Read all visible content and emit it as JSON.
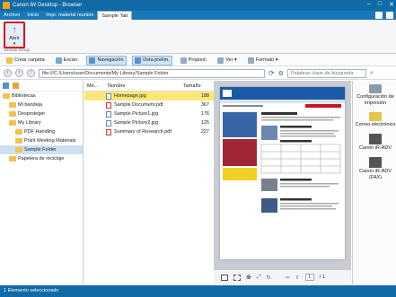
{
  "window": {
    "title": "Canon iW Desktop - Browser",
    "controls": [
      "–",
      "□",
      "✕"
    ]
  },
  "menubar": {
    "tabs": [
      {
        "label": "Archivo",
        "active": false
      },
      {
        "label": "Inicio",
        "active": false
      },
      {
        "label": "Impr. material reunión",
        "active": false
      },
      {
        "label": "Sample Tab",
        "active": true
      }
    ]
  },
  "ribbon": {
    "open_label": "Abrir",
    "group_label": "Sample Group"
  },
  "toolbar": {
    "items": [
      {
        "label": "Crear carpeta",
        "active": false
      },
      {
        "label": "Escan.",
        "active": false
      },
      {
        "label": "Navegación",
        "active": true
      },
      {
        "label": "Vista prelim.",
        "active": true
      },
      {
        "label": "Propied.",
        "active": false
      },
      {
        "label": "Ver ▾",
        "active": false
      },
      {
        "label": "Formato ▾",
        "active": false
      }
    ]
  },
  "address": {
    "path": "file:///C:/Users/user/Documents/My Library/Sample Folder",
    "search_placeholder": "Palabras clave de búsqueda"
  },
  "tree": {
    "items": [
      {
        "label": "Bibliotecas",
        "indent": 0,
        "selected": false,
        "icon": "library-icon"
      },
      {
        "label": "Mi bandeja",
        "indent": 1,
        "selected": false,
        "icon": "tray-icon"
      },
      {
        "label": "Desproteger",
        "indent": 1,
        "selected": false,
        "icon": "checkout-icon"
      },
      {
        "label": "My Library",
        "indent": 1,
        "selected": false,
        "icon": "library-icon"
      },
      {
        "label": "PDF Handling",
        "indent": 2,
        "selected": false,
        "icon": "folder-icon"
      },
      {
        "label": "Point Meeting Materials",
        "indent": 2,
        "selected": false,
        "icon": "folder-icon"
      },
      {
        "label": "Sample Folder",
        "indent": 2,
        "selected": true,
        "icon": "folder-icon"
      },
      {
        "label": "Papelera de reciclaje",
        "indent": 1,
        "selected": false,
        "icon": "recycle-bin-icon"
      }
    ]
  },
  "list": {
    "headers": {
      "mark": "Me...",
      "name": "Nombre",
      "size": "Tamaño"
    },
    "rows": [
      {
        "name": "Homepage.jpg",
        "size": "188",
        "type": "img",
        "selected": true
      },
      {
        "name": "Sample Document.pdf",
        "size": "367",
        "type": "pdf",
        "selected": false
      },
      {
        "name": "Sample Picture1.jpg",
        "size": "176",
        "type": "img",
        "selected": false
      },
      {
        "name": "Sample Picture2.jpg",
        "size": "125",
        "type": "img",
        "selected": false
      },
      {
        "name": "Summary of Research.pdf",
        "size": "227",
        "type": "pdf",
        "selected": false
      }
    ]
  },
  "preview": {
    "page_number": "1",
    "page_total": "/ 1"
  },
  "right_panel": {
    "items": [
      "Configuración de impresión",
      "Correo electrónico",
      "Canon iR-ADV",
      "Canon iR-ADV (FAX)"
    ]
  },
  "status": {
    "text": "1 Elemento seleccionado"
  }
}
